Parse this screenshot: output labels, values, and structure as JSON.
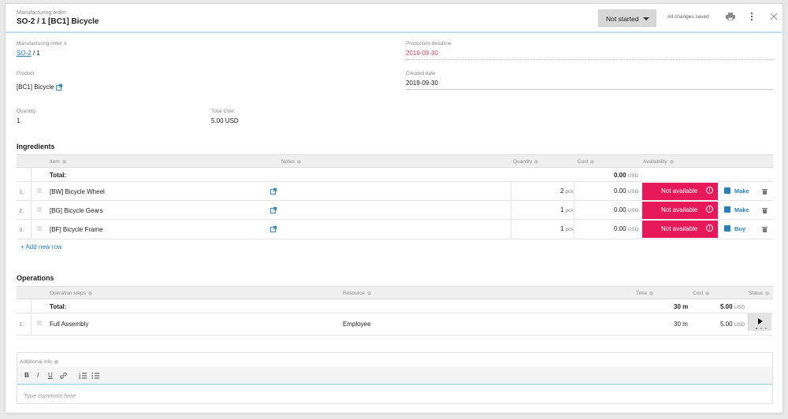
{
  "header": {
    "subtitle": "Manufacturing order",
    "title": "SO-2 / 1 [BC1] Bicycle",
    "status": "Not started",
    "saved": "All changes saved"
  },
  "fields": {
    "mo_label": "Manufacturing order #",
    "mo_link": "SO-2",
    "mo_suffix": " / 1",
    "deadline_label": "Production deadline",
    "deadline_value": "2019-09-30",
    "product_label": "Product",
    "product_value": "[BC1] Bicycle",
    "created_label": "Created date",
    "created_value": "2019-09-30",
    "qty_label": "Quantity",
    "qty_value": "1",
    "cost_label": "Total Cost",
    "cost_value": "5.00 USD"
  },
  "ingredients": {
    "title": "Ingredients",
    "columns": {
      "item": "Item",
      "notes": "Notes",
      "quantity": "Quantity",
      "cost": "Cost",
      "availability": "Availability"
    },
    "total_label": "Total:",
    "total_cost": "0.00",
    "total_unit": "USD",
    "rows": [
      {
        "num": "1.",
        "item": "[BW] Bicycle Wheel",
        "qty": "2",
        "unit": "pcs",
        "cost": "0.00",
        "cur": "USD",
        "availability": "Not available",
        "action": "Make"
      },
      {
        "num": "2.",
        "item": "[BG] Bicycle Gears",
        "qty": "1",
        "unit": "pcs",
        "cost": "0.00",
        "cur": "USD",
        "availability": "Not available",
        "action": "Make"
      },
      {
        "num": "3.",
        "item": "[BF] Bicycle Frame",
        "qty": "1",
        "unit": "pcs",
        "cost": "0.00",
        "cur": "USD",
        "availability": "Not available",
        "action": "Buy"
      }
    ],
    "add_row": "+ Add new row"
  },
  "operations": {
    "title": "Operations",
    "columns": {
      "steps": "Operation steps",
      "resource": "Resource",
      "time": "Time",
      "cost": "Cost",
      "status": "Status"
    },
    "total_label": "Total:",
    "total_time": "30 m",
    "total_cost": "5.00",
    "total_unit": "USD",
    "rows": [
      {
        "num": "1.",
        "step": "Full Assembly",
        "resource": "Employee",
        "time": "30 m",
        "cost": "5.00",
        "cur": "USD"
      }
    ]
  },
  "editor": {
    "label": "Additional info",
    "placeholder": "Type comment here",
    "bold": "B",
    "italic": "I",
    "underline": "U"
  },
  "colors": {
    "accent": "#2a7fb8",
    "not_available": "#e8195a",
    "deadline": "#d24b6a"
  }
}
